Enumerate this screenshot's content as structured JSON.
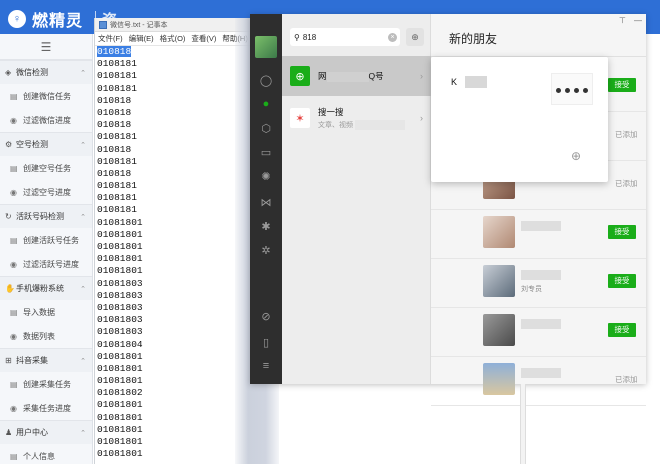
{
  "app": {
    "name": "燃精灵",
    "extra": "资"
  },
  "sidebar": {
    "groups": [
      {
        "label": "微信检测",
        "items": [
          "创建微信任务",
          "过滤微信进度"
        ]
      },
      {
        "label": "空号检测",
        "items": [
          "创建空号任务",
          "过滤空号进度"
        ]
      },
      {
        "label": "活跃号码检测",
        "items": [
          "创建活跃号任务",
          "过滤活跃号进度"
        ]
      },
      {
        "label": "手机爆粉系统",
        "items": [
          "导入数据",
          "数据列表"
        ]
      },
      {
        "label": "抖音采集",
        "items": [
          "创建采集任务",
          "采集任务进度"
        ]
      },
      {
        "label": "用户中心",
        "items": [
          "个人信息"
        ]
      }
    ]
  },
  "notepad": {
    "title": "微信号.txt - 记事本",
    "menu": [
      "文件(F)",
      "编辑(E)",
      "格式(O)",
      "查看(V)",
      "帮助(H)"
    ],
    "lines": [
      "010818",
      "0108181",
      "0108181",
      "0108181",
      "010818",
      "010818",
      "010818",
      "0108181",
      "010818",
      "0108181",
      "010818",
      "0108181",
      "0108181",
      "0108181",
      "01081801",
      "01081801",
      "01081801",
      "01081801",
      "01081801",
      "01081803",
      "01081803",
      "01081803",
      "01081803",
      "01081803",
      "01081804",
      "01081801",
      "01081801",
      "01081801",
      "01081802",
      "01081801",
      "01081801",
      "01081801",
      "01081801",
      "01081801"
    ]
  },
  "wechat": {
    "search": {
      "query": "818"
    },
    "list": {
      "row1": {
        "prefix": "网",
        "suffix": "Q号"
      },
      "row2": {
        "label": "搜一搜",
        "sub": "文章、视频"
      }
    },
    "main": {
      "title": "新的朋友",
      "accept": "接受",
      "added": "已添加",
      "friends": [
        {
          "note": "",
          "status": "accept"
        },
        {
          "note": "",
          "status": "added"
        },
        {
          "note": "",
          "status": "added"
        },
        {
          "note": "",
          "status": "accept"
        },
        {
          "note": "刘专员",
          "status": "accept"
        },
        {
          "note": "",
          "status": "accept"
        },
        {
          "note": "",
          "status": "added"
        }
      ]
    },
    "popup": {
      "name": "K"
    }
  }
}
